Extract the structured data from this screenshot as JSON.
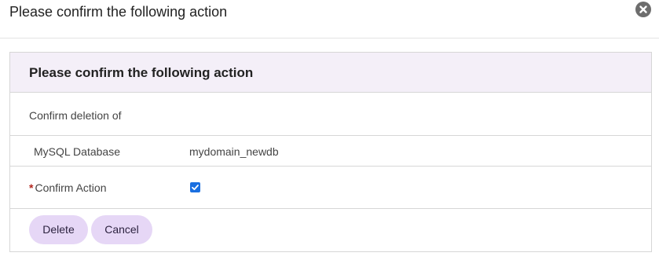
{
  "dialog": {
    "title": "Please confirm the following action",
    "close_icon": "close-circle-icon"
  },
  "panel": {
    "title": "Please confirm the following action",
    "intro": "Confirm deletion of",
    "item": {
      "label": "MySQL Database",
      "value": "mydomain_newdb"
    },
    "confirm": {
      "required_marker": "*",
      "label": "Confirm Action",
      "checked": true
    },
    "buttons": {
      "delete": "Delete",
      "cancel": "Cancel"
    }
  },
  "colors": {
    "panel_header_bg": "#f4eff8",
    "button_bg": "#e6d7f6",
    "checkbox_accent": "#1a6fe0",
    "required_star": "#b3261e"
  }
}
